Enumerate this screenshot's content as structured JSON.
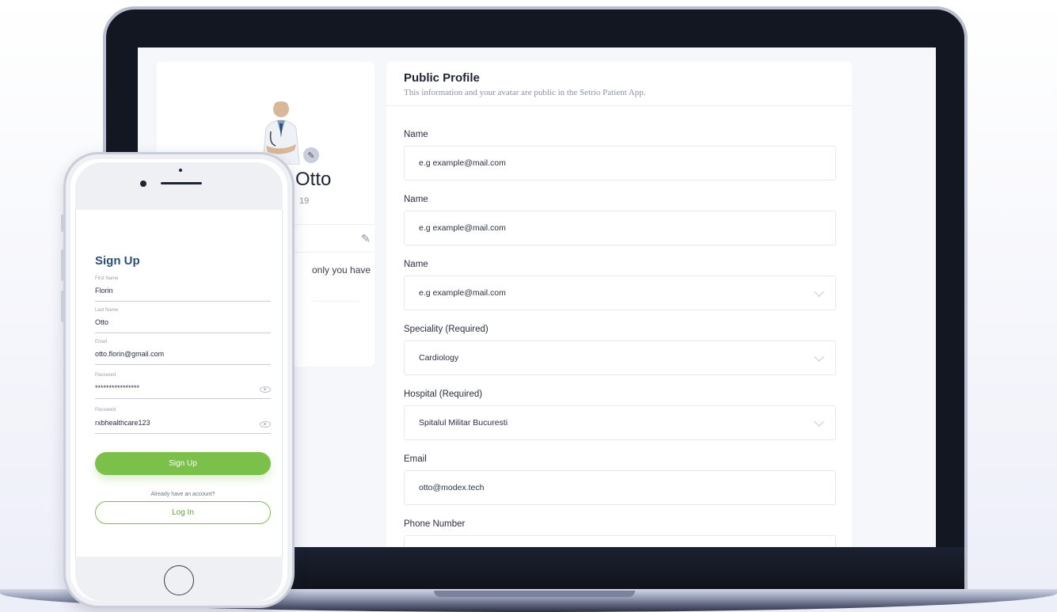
{
  "profile": {
    "name": "Otto",
    "sub": "19",
    "note": "only you have"
  },
  "form": {
    "title": "Public Profile",
    "subtitle": "This information and your avatar are public in the Setrio Patient App.",
    "fields": [
      {
        "label": "Name",
        "value": "e.g example@mail.com",
        "dropdown": false
      },
      {
        "label": "Name",
        "value": "e.g example@mail.com",
        "dropdown": false
      },
      {
        "label": "Name",
        "value": "e.g example@mail.com",
        "dropdown": true
      },
      {
        "label": "Speciality (Required)",
        "value": "Cardiology",
        "dropdown": true
      },
      {
        "label": "Hospital (Required)",
        "value": "Spitalul Militar Bucuresti",
        "dropdown": true
      },
      {
        "label": "Email",
        "value": "otto@modex.tech",
        "dropdown": false
      },
      {
        "label": "Phone Number",
        "value": "",
        "dropdown": false
      }
    ]
  },
  "signup": {
    "title": "Sign Up",
    "first_name_label": "First Name",
    "first_name_value": "Florin",
    "last_name_label": "Last Name",
    "last_name_value": "Otto",
    "email_label": "Email",
    "email_value": "otto.florin@gmail.com",
    "password_label": "Password",
    "password_value": "****************",
    "password2_label": "Password",
    "password2_value": "rxbhealthcare123",
    "signup_button": "Sign Up",
    "already": "Already have an account?",
    "login_button": "Log In"
  },
  "colors": {
    "accent_green": "#7cc04c",
    "title_blue": "#2b4f73"
  }
}
